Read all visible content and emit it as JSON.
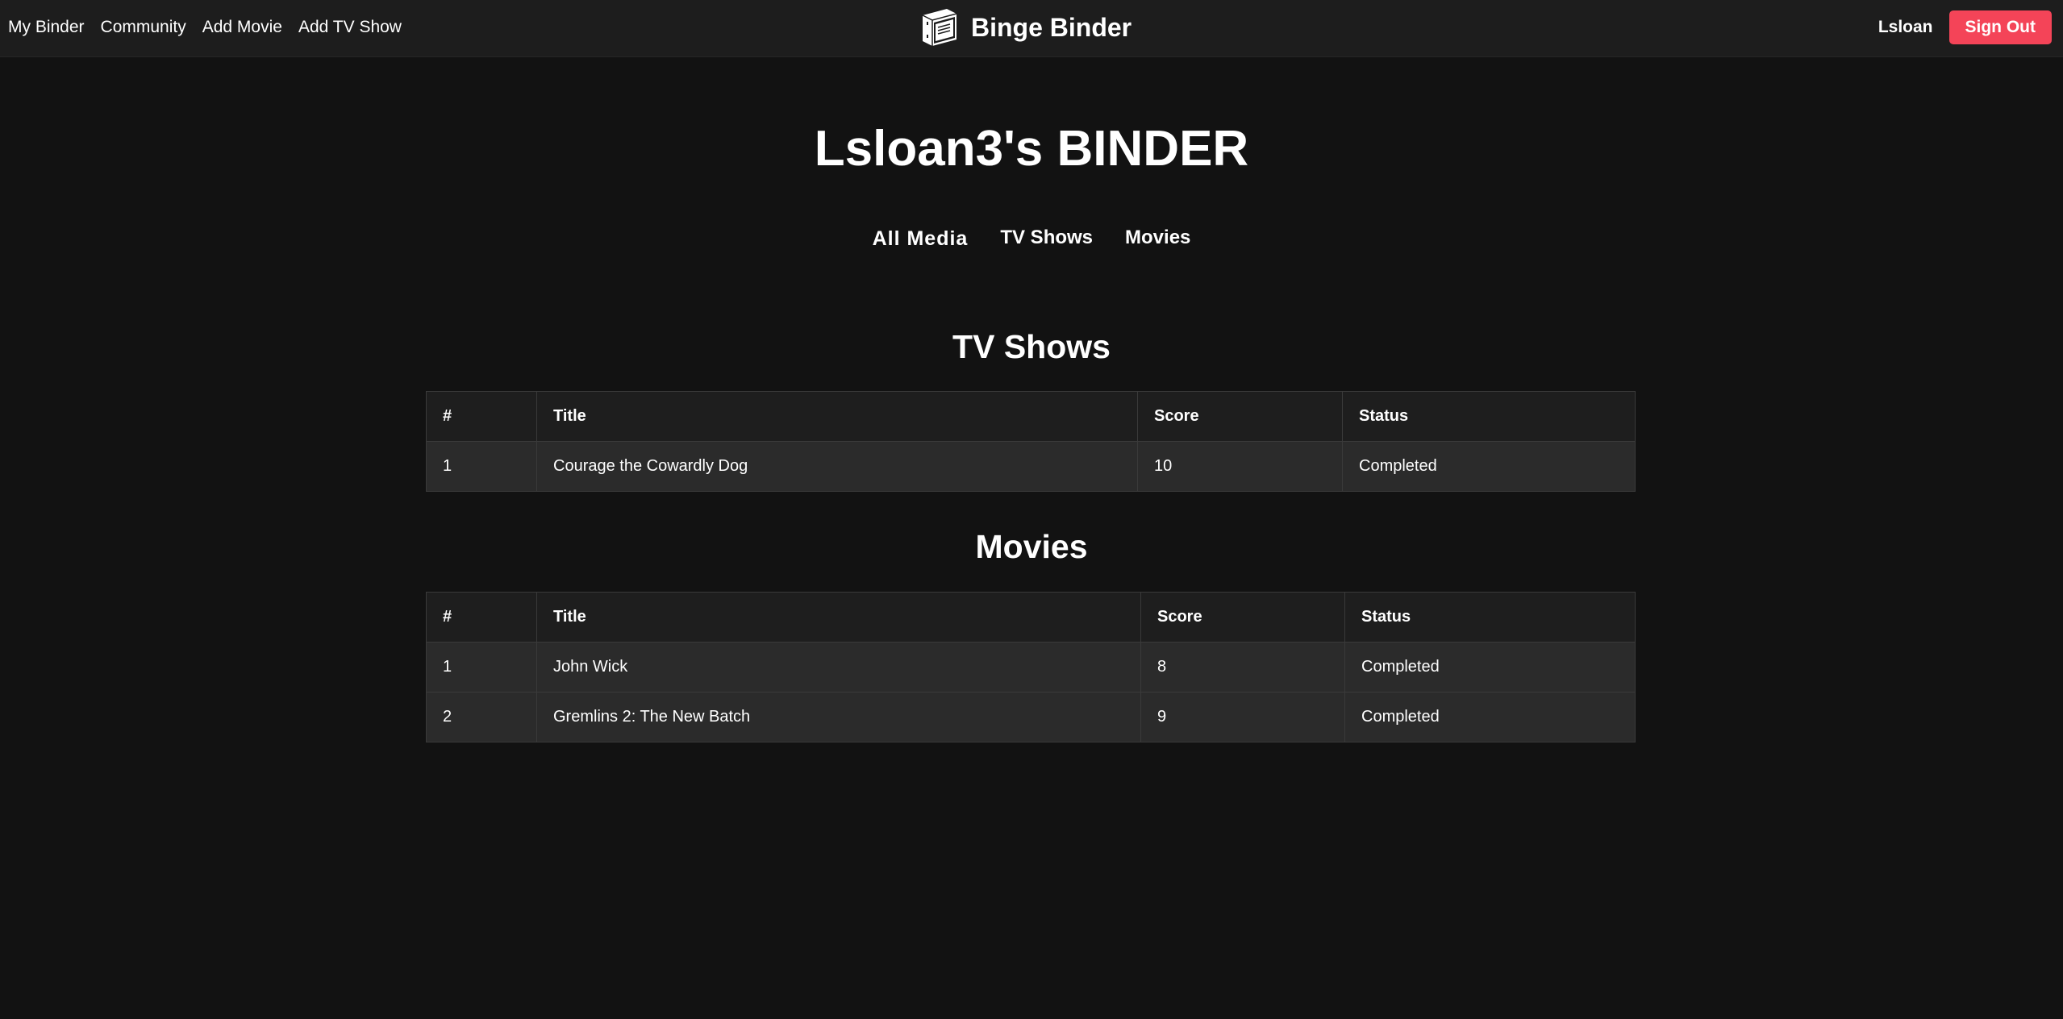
{
  "nav": {
    "links": [
      "My Binder",
      "Community",
      "Add Movie",
      "Add TV Show"
    ],
    "brand": "Binge Binder",
    "brand_icon": "binder-icon",
    "username": "Lsloan",
    "signout_label": "Sign Out"
  },
  "colors": {
    "background": "#121212",
    "navbar": "#1d1d1d",
    "accent": "#f44458",
    "table_header": "#1e1e1e",
    "table_row": "#2b2b2b"
  },
  "page": {
    "title": "Lsloan3's BINDER"
  },
  "filters": {
    "all": "All Media",
    "tv": "TV Shows",
    "movies": "Movies",
    "active": "All Media"
  },
  "tv_section": {
    "title": "TV Shows",
    "headers": [
      "#",
      "Title",
      "Score",
      "Status"
    ],
    "rows": [
      [
        "1",
        "Courage the Cowardly Dog",
        "10",
        "Completed"
      ]
    ]
  },
  "movie_section": {
    "title": "Movies",
    "headers": [
      "#",
      "Title",
      "Score",
      "Status"
    ],
    "rows": [
      [
        "1",
        "John Wick",
        "8",
        "Completed"
      ],
      [
        "2",
        "Gremlins 2: The New Batch",
        "9",
        "Completed"
      ]
    ]
  }
}
